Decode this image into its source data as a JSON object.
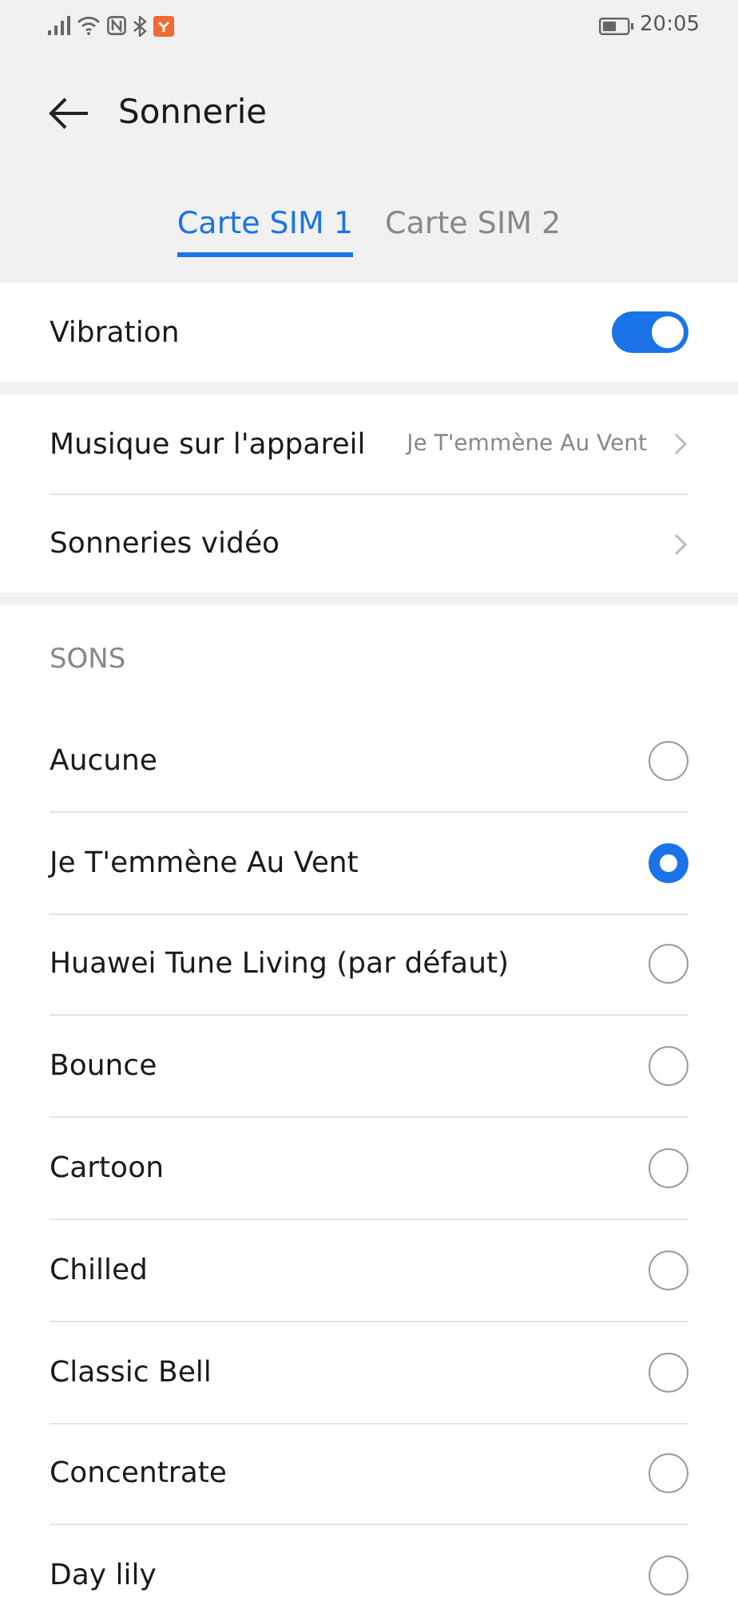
{
  "status_bar": {
    "time": "20:05"
  },
  "header": {
    "title": "Sonnerie"
  },
  "tabs": [
    {
      "label": "Carte SIM 1",
      "selected": true
    },
    {
      "label": "Carte SIM 2",
      "selected": false
    }
  ],
  "vibration": {
    "label": "Vibration",
    "on": true
  },
  "links": [
    {
      "label": "Musique sur l'appareil",
      "value": "Je T'emmène Au Vent"
    },
    {
      "label": "Sonneries vidéo"
    }
  ],
  "sounds": {
    "title": "SONS",
    "items": [
      {
        "label": "Aucune",
        "selected": false
      },
      {
        "label": "Je T'emmène Au Vent",
        "selected": true
      },
      {
        "label": "Huawei Tune Living (par défaut)",
        "selected": false
      },
      {
        "label": "Bounce",
        "selected": false
      },
      {
        "label": "Cartoon",
        "selected": false
      },
      {
        "label": "Chilled",
        "selected": false
      },
      {
        "label": "Classic Bell",
        "selected": false
      },
      {
        "label": "Concentrate",
        "selected": false
      },
      {
        "label": "Day lily",
        "selected": false
      }
    ]
  }
}
